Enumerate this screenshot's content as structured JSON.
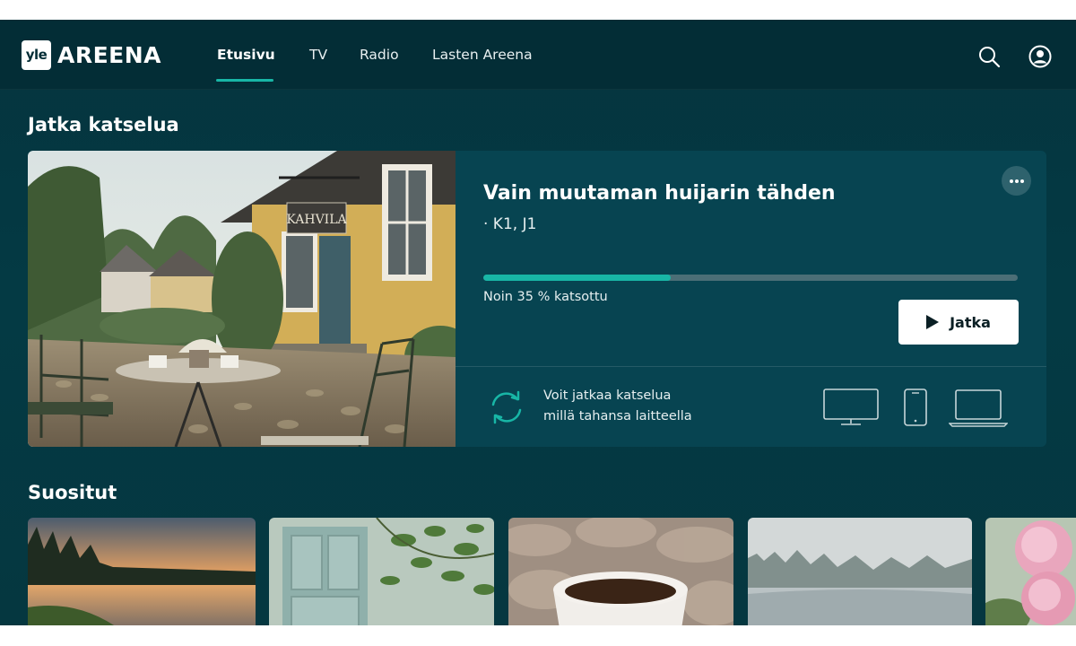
{
  "header": {
    "logo_mark": "yle",
    "logo_word": "AREENA",
    "nav": [
      {
        "label": "Etusivu",
        "active": true
      },
      {
        "label": "TV",
        "active": false
      },
      {
        "label": "Radio",
        "active": false
      },
      {
        "label": "Lasten Areena",
        "active": false
      }
    ],
    "icons": [
      "search-icon",
      "account-icon"
    ]
  },
  "continue_watching": {
    "section_title": "Jatka katselua",
    "item": {
      "title": "Vain muutaman huijarin tähden",
      "meta": "· K1, J1",
      "image_sign": "KAHVILA",
      "progress": 0.35,
      "progress_label": "Noin 35 % katsottu",
      "play_label": "Jatka",
      "more_icon": "more-horizontal-icon"
    },
    "devices": {
      "line1": "Voit jatkaa katselua",
      "line2": "millä tahansa laitteella",
      "icons": [
        "sync-icon",
        "tv-icon",
        "phone-icon",
        "laptop-icon"
      ]
    }
  },
  "popular": {
    "section_title": "Suositut",
    "items": [
      "lake-sunset-thumbnail",
      "window-vines-thumbnail",
      "coffee-knit-thumbnail",
      "misty-lake-thumbnail",
      "pink-flowers-thumbnail"
    ]
  },
  "colors": {
    "accent": "#18b6a6",
    "background": "#043a44",
    "header": "#032d36",
    "card": "#074451"
  }
}
